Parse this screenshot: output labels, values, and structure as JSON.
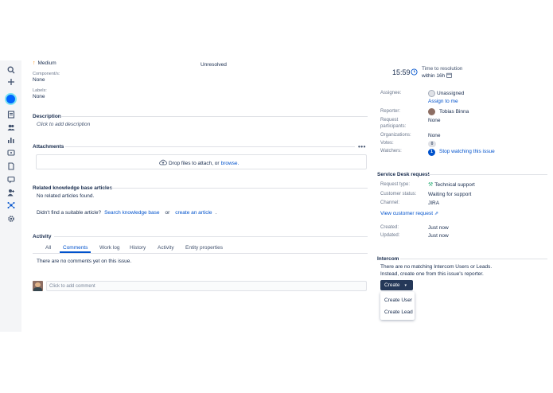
{
  "left": {
    "priority": "Medium",
    "components_label": "Component/s:",
    "components_value": "None",
    "labels_label": "Labels:",
    "labels_value": "None",
    "status": "Unresolved",
    "description_heading": "Description",
    "description_placeholder": "Click to add description",
    "attachments_heading": "Attachments",
    "drop_text": "Drop files to attach, or",
    "browse_link": "browse.",
    "kb_heading": "Related knowledge base articles",
    "kb_none": "No related articles found.",
    "kb_question": "Didn't find a suitable article?",
    "kb_search_link": "Search knowledge base",
    "kb_or": "or",
    "kb_create_link": "create an article",
    "kb_dot": ".",
    "activity_heading": "Activity",
    "tabs": [
      "All",
      "Comments",
      "Work log",
      "History",
      "Activity",
      "Entity properties"
    ],
    "active_tab": "Comments",
    "no_comments": "There are no comments yet on this issue.",
    "comment_placeholder": "Click to add comment"
  },
  "right": {
    "sla_time": "15:59",
    "sla_title": "Time to resolution",
    "sla_within": "within 16h",
    "assignee_label": "Assignee:",
    "assignee_value": "Unassigned",
    "assign_to_me": "Assign to me",
    "reporter_label": "Reporter:",
    "reporter_value": "Tobias Binna",
    "request_participants_label_1": "Request",
    "request_participants_label_2": "participants:",
    "request_participants_value": "None",
    "organizations_label": "Organizations:",
    "organizations_value": "None",
    "votes_label": "Votes:",
    "votes_value": "0",
    "watchers_label": "Watchers:",
    "watchers_count": "1",
    "stop_watching": "Stop watching this issue",
    "sd_heading": "Service Desk request",
    "request_type_label": "Request type:",
    "request_type_value": "Technical support",
    "customer_status_label": "Customer status:",
    "customer_status_value": "Waiting for support",
    "channel_label": "Channel:",
    "channel_value": "JIRA",
    "view_request_link": "View customer request",
    "created_label": "Created:",
    "created_value": "Just now",
    "updated_label": "Updated:",
    "updated_value": "Just now",
    "intercom_heading": "Intercom",
    "intercom_line1": "There are no matching Intercom Users or Leads.",
    "intercom_line2": "Instead, create one from this issue's reporter.",
    "create_button": "Create",
    "dropdown_items": [
      "Create User",
      "Create Lead"
    ]
  },
  "colors": {
    "link": "#0052cc",
    "primary_dark": "#253858",
    "sidebar_bg": "#f4f5f7",
    "priority_medium": "#ff8b00"
  }
}
